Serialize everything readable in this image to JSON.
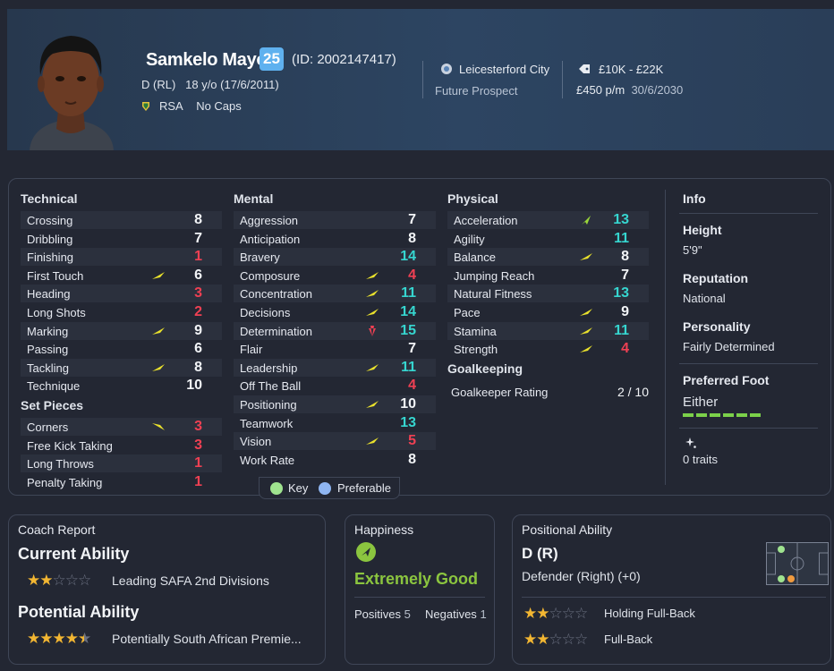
{
  "player": {
    "name": "Samkelo Mayo",
    "number": "25",
    "id_text": "(ID: 2002147417)",
    "position_age": "D (RL)",
    "age_dob": "18 y/o (17/6/2011)",
    "nation": "RSA",
    "caps": "No Caps"
  },
  "club": {
    "name": "Leicesterford City",
    "status": "Future Prospect"
  },
  "contract": {
    "value": "£10K - £22K",
    "wage": "£450 p/m",
    "expiry": "30/6/2030"
  },
  "technical": {
    "title": "Technical",
    "rows": [
      {
        "label": "Crossing",
        "value": "8"
      },
      {
        "label": "Dribbling",
        "value": "7"
      },
      {
        "label": "Finishing",
        "value": "1"
      },
      {
        "label": "First Touch",
        "value": "6"
      },
      {
        "label": "Heading",
        "value": "3"
      },
      {
        "label": "Long Shots",
        "value": "2"
      },
      {
        "label": "Marking",
        "value": "9"
      },
      {
        "label": "Passing",
        "value": "6"
      },
      {
        "label": "Tackling",
        "value": "8"
      },
      {
        "label": "Technique",
        "value": "10"
      }
    ]
  },
  "set_pieces": {
    "title": "Set Pieces",
    "rows": [
      {
        "label": "Corners",
        "value": "3"
      },
      {
        "label": "Free Kick Taking",
        "value": "3"
      },
      {
        "label": "Long Throws",
        "value": "1"
      },
      {
        "label": "Penalty Taking",
        "value": "1"
      }
    ]
  },
  "mental": {
    "title": "Mental",
    "rows": [
      {
        "label": "Aggression",
        "value": "7"
      },
      {
        "label": "Anticipation",
        "value": "8"
      },
      {
        "label": "Bravery",
        "value": "14"
      },
      {
        "label": "Composure",
        "value": "4"
      },
      {
        "label": "Concentration",
        "value": "11"
      },
      {
        "label": "Decisions",
        "value": "14"
      },
      {
        "label": "Determination",
        "value": "15"
      },
      {
        "label": "Flair",
        "value": "7"
      },
      {
        "label": "Leadership",
        "value": "11"
      },
      {
        "label": "Off The Ball",
        "value": "4"
      },
      {
        "label": "Positioning",
        "value": "10"
      },
      {
        "label": "Teamwork",
        "value": "13"
      },
      {
        "label": "Vision",
        "value": "5"
      },
      {
        "label": "Work Rate",
        "value": "8"
      }
    ]
  },
  "physical": {
    "title": "Physical",
    "rows": [
      {
        "label": "Acceleration",
        "value": "13"
      },
      {
        "label": "Agility",
        "value": "11"
      },
      {
        "label": "Balance",
        "value": "8"
      },
      {
        "label": "Jumping Reach",
        "value": "7"
      },
      {
        "label": "Natural Fitness",
        "value": "13"
      },
      {
        "label": "Pace",
        "value": "9"
      },
      {
        "label": "Stamina",
        "value": "11"
      },
      {
        "label": "Strength",
        "value": "4"
      }
    ]
  },
  "goalkeeping": {
    "title": "Goalkeeping",
    "label": "Goalkeeper Rating",
    "value": "2 / 10"
  },
  "info": {
    "title": "Info",
    "height_label": "Height",
    "height": "5'9\"",
    "reputation_label": "Reputation",
    "reputation": "National",
    "personality_label": "Personality",
    "personality": "Fairly Determined",
    "foot_label": "Preferred Foot",
    "foot": "Either",
    "traits": "0 traits"
  },
  "legend": {
    "key": "Key",
    "preferable": "Preferable"
  },
  "coach_report": {
    "title": "Coach Report",
    "current_label": "Current Ability",
    "current_stars": 2,
    "current_text": "Leading SAFA 2nd Divisions",
    "potential_label": "Potential Ability",
    "potential_stars": 4.5,
    "potential_text": "Potentially South African Premie..."
  },
  "happiness": {
    "title": "Happiness",
    "level": "Extremely Good",
    "positives_label": "Positives",
    "positives": "5",
    "negatives_label": "Negatives",
    "negatives": "1"
  },
  "positional": {
    "title": "Positional Ability",
    "position": "D (R)",
    "description": "Defender (Right) (+0)",
    "roles": [
      {
        "label": "Holding Full-Back",
        "stars": 2
      },
      {
        "label": "Full-Back",
        "stars": 2
      }
    ]
  },
  "colors": {
    "white": "#f2f4f7",
    "red": "#ef4053",
    "cyan": "#36d6d0",
    "star": "#f2b632",
    "green": "#8bc53f"
  }
}
